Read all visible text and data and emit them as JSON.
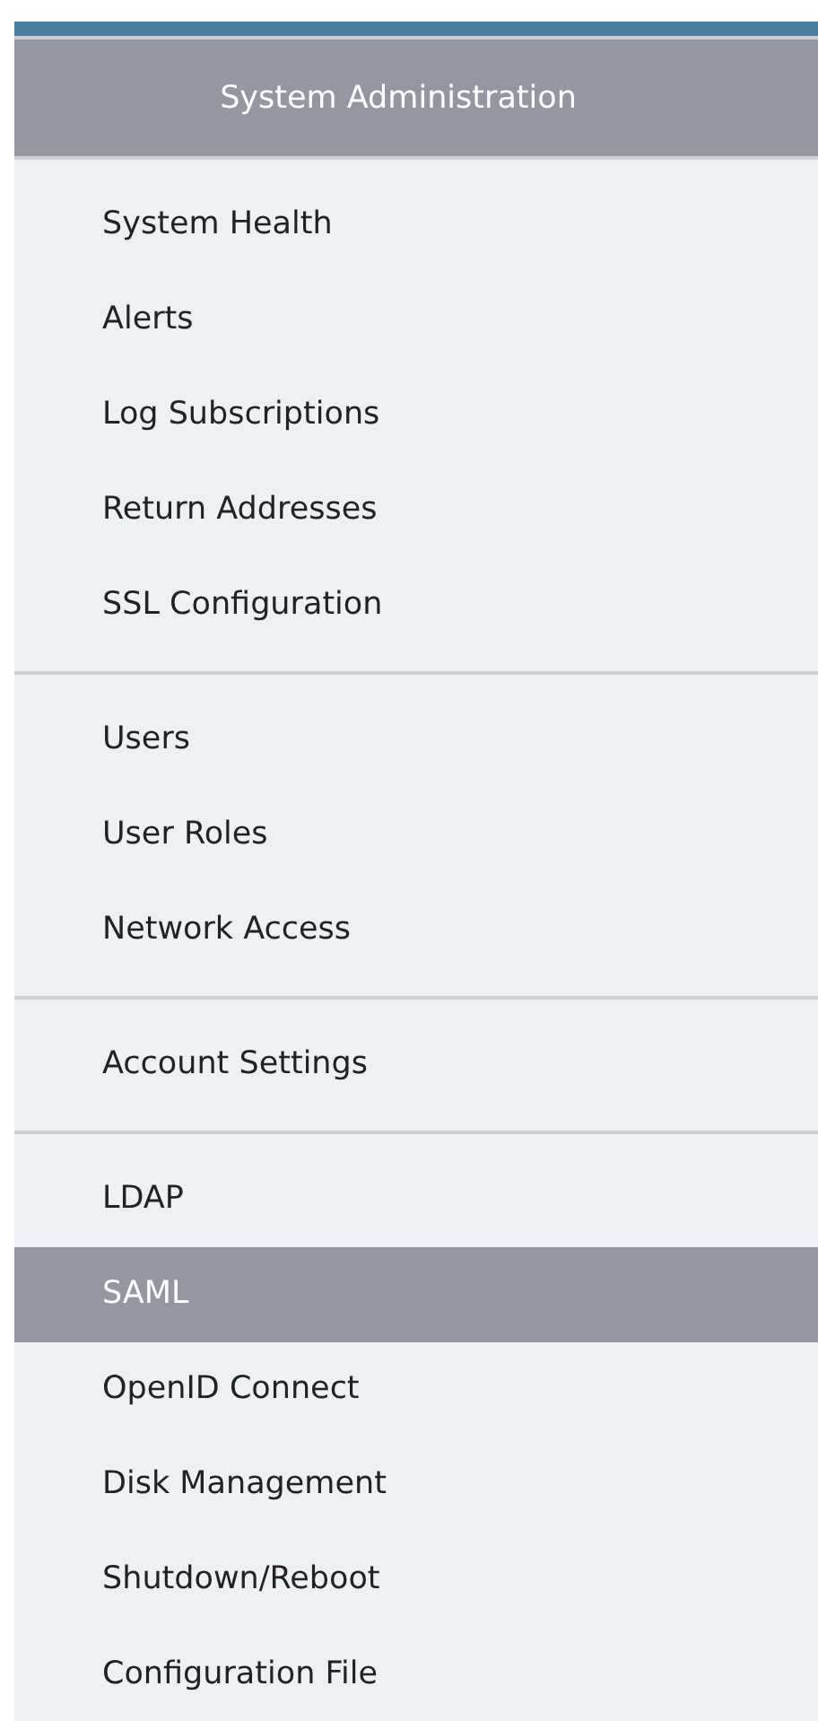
{
  "menu": {
    "title": "System Administration",
    "groups": [
      {
        "items": [
          {
            "label": "System Health",
            "selected": false
          },
          {
            "label": "Alerts",
            "selected": false
          },
          {
            "label": "Log Subscriptions",
            "selected": false
          },
          {
            "label": "Return Addresses",
            "selected": false
          },
          {
            "label": "SSL Configuration",
            "selected": false
          }
        ]
      },
      {
        "items": [
          {
            "label": "Users",
            "selected": false
          },
          {
            "label": "User Roles",
            "selected": false
          },
          {
            "label": "Network Access",
            "selected": false
          }
        ]
      },
      {
        "items": [
          {
            "label": "Account Settings",
            "selected": false
          }
        ]
      },
      {
        "items": [
          {
            "label": "LDAP",
            "selected": false
          },
          {
            "label": "SAML",
            "selected": true
          },
          {
            "label": "OpenID Connect",
            "selected": false
          },
          {
            "label": "Disk Management",
            "selected": false
          },
          {
            "label": "Shutdown/Reboot",
            "selected": false
          },
          {
            "label": "Configuration File",
            "selected": false
          }
        ]
      }
    ]
  }
}
